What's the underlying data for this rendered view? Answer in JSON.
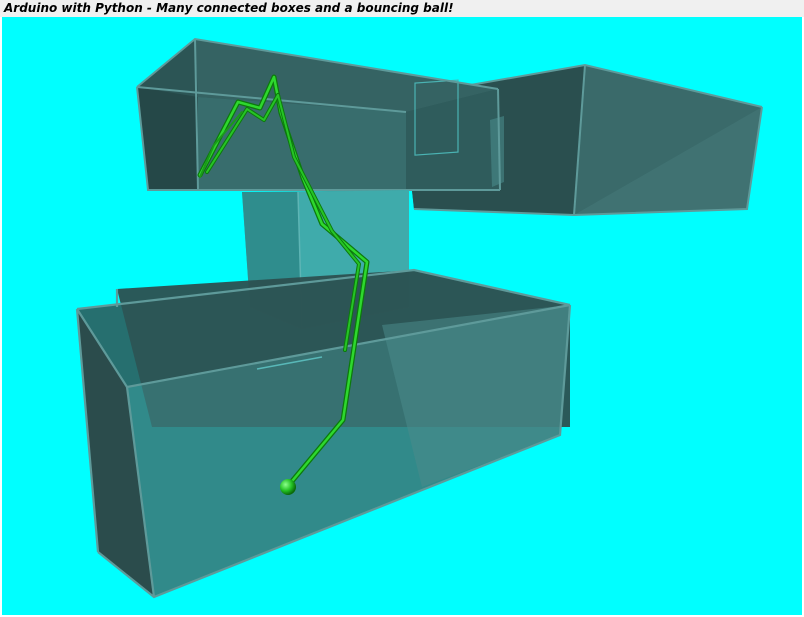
{
  "window": {
    "title": "Arduino with Python - Many connected boxes and a bouncing ball!"
  },
  "scene": {
    "background_color": "#00ffff",
    "box_color": "#2f6f6f",
    "edge_color": "#5e9a9a",
    "trail_color": "#1ecf1e",
    "ball_color": "#22c022",
    "box_count": 4,
    "objects": [
      "upper-box",
      "right-box",
      "center-pillar-box",
      "lower-box",
      "ball-trail",
      "ball"
    ]
  }
}
